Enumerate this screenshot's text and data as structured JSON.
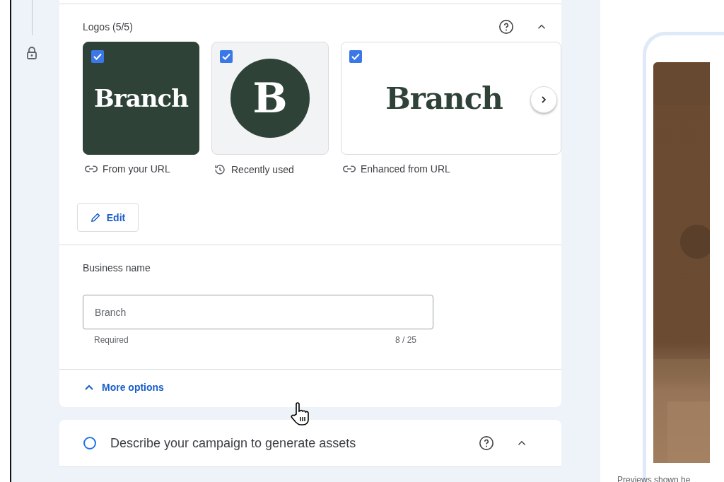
{
  "logos": {
    "title": "Logos (5/5)",
    "expanded": true,
    "items": [
      {
        "kind": "dark-wordmark",
        "logo_text": "Branch",
        "checked": true,
        "caption": {
          "kind": "link",
          "text": "From your URL"
        }
      },
      {
        "kind": "monogram",
        "logo_text": "B",
        "checked": true,
        "caption": {
          "kind": "history",
          "text": "Recently used"
        }
      },
      {
        "kind": "light-wordmark",
        "logo_text": "Branch",
        "checked": true,
        "caption": {
          "kind": "link",
          "text": "Enhanced from URL"
        }
      }
    ],
    "edit_button": "Edit"
  },
  "business_name": {
    "label": "Business name",
    "value": "Branch",
    "helper": "Required",
    "counter": "8 / 25"
  },
  "more_options": {
    "label": "More options",
    "expanded": true
  },
  "describe_section": {
    "title": "Describe your campaign to generate assets",
    "done": false,
    "expanded": true
  },
  "preview": {
    "footer": "Previews shown he"
  }
}
